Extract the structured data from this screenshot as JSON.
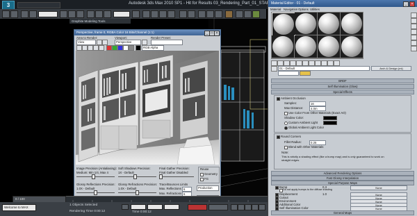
{
  "app": {
    "logo": "3",
    "title": "Autodesk 3ds Max 2010 SP1 - Hit for Results  03_Rendering_Part_01_START.max"
  },
  "toolbar": {
    "ribbon_tab": "Graphite Modeling Tools"
  },
  "render_window": {
    "title": "Perspective, frame 0, RGBA Color 16 Bits/Channel (1:1)",
    "area_to_render_label": "Area to Render:",
    "area_to_render_value": "View",
    "viewport_label": "Viewport:",
    "viewport_value": "Perspective",
    "render_preset_label": "Render Preset:",
    "render_preset_value": "",
    "channel_value": "RGB Alpha",
    "bottom": {
      "image_precision_label": "Image Precision (Antialiasing):",
      "image_precision_value": "Medium: Min 1/4, Max 4",
      "soft_shadows_label": "Soft Shadows Precision:",
      "soft_shadows_value": "1X - Default",
      "final_gather_precision_label": "Final Gather Precision:",
      "final_gather_precision_value": "Final Gather Disabled",
      "reuse_label": "Reuse",
      "geometry_label": "Geometry",
      "fg_label": "FG",
      "glossy_reflections_label": "Glossy Reflections Precision:",
      "glossy_reflections_value": "1.0X - Default",
      "glossy_refractions_label": "Glossy Refractions Precision:",
      "glossy_refractions_value": "1.0X - Default",
      "trace_bounces_label": "Trace/Bounces Limits",
      "max_reflections_label": "Max. Reflections",
      "max_reflections_value": "6",
      "max_refractions_label": "Max. Refractions",
      "max_refractions_value": "6",
      "fg_bounces_label": "FG Bounces",
      "fg_bounces_value": "0",
      "production_value": "Production",
      "render_button": "Render"
    }
  },
  "material_editor": {
    "title": "Material Editor - 01 - Default",
    "menu": [
      "Material",
      "Navigation",
      "Options",
      "Utilities"
    ],
    "material_name": "01 - Default",
    "material_type": "Arch & Design (mi)",
    "rollouts": {
      "brdf": "BRDF",
      "self_illum": "Self Illumination (Glow)",
      "special_effects": "Special Effects",
      "advanced_rendering": "Advanced Rendering Options",
      "fast_glossy": "Fast Glossy Interpolation",
      "special_purpose_maps": "Special Purpose Maps",
      "general_maps": "General Maps",
      "mr_connection": "mental ray Connection"
    },
    "ao": {
      "enabled_label": "Ambient Occlusion",
      "samples_label": "Samples:",
      "samples_value": "16",
      "max_distance_label": "Max Distance:",
      "max_distance_value": "4.0m",
      "use_color_label": "Use Color From Other Materials (Exact AO)",
      "shadow_color_label": "Shadow Color:",
      "custom_ambient_label": "Custom Ambient Light",
      "global_ambient_label": "Global Ambient Light Color"
    },
    "round_corners": {
      "enabled_label": "Round Corners",
      "fillet_label": "Fillet Radius:",
      "fillet_value": "0.25",
      "blend_label": "Blend with Other Materials",
      "note_label": "Note:",
      "note_text": "This is strictly a shading effect (like a bump map) and is only guaranteed to work on straight edges."
    },
    "maps": [
      {
        "label": "Bump",
        "amount": "0.3",
        "map": "None"
      },
      {
        "label": "Do not apply bumps to the diffuse shading",
        "amount": "",
        "map": ""
      },
      {
        "label": "Displacement",
        "amount": "1.0",
        "map": "None"
      },
      {
        "label": "Cutout",
        "amount": "",
        "map": "None"
      },
      {
        "label": "Environment",
        "amount": "",
        "map": "None"
      },
      {
        "label": "Additional Color",
        "amount": "",
        "map": "None"
      },
      {
        "label": "Self Illumination Color",
        "amount": "",
        "map": "None"
      }
    ]
  },
  "status": {
    "objects_selected": "1 Objects Selected",
    "rendering_time": "Rendering Time 0:00:12",
    "welcome": "Welcome to MAX",
    "time_label": "Time 0:00:12",
    "frame_counter": "0 / 100"
  }
}
